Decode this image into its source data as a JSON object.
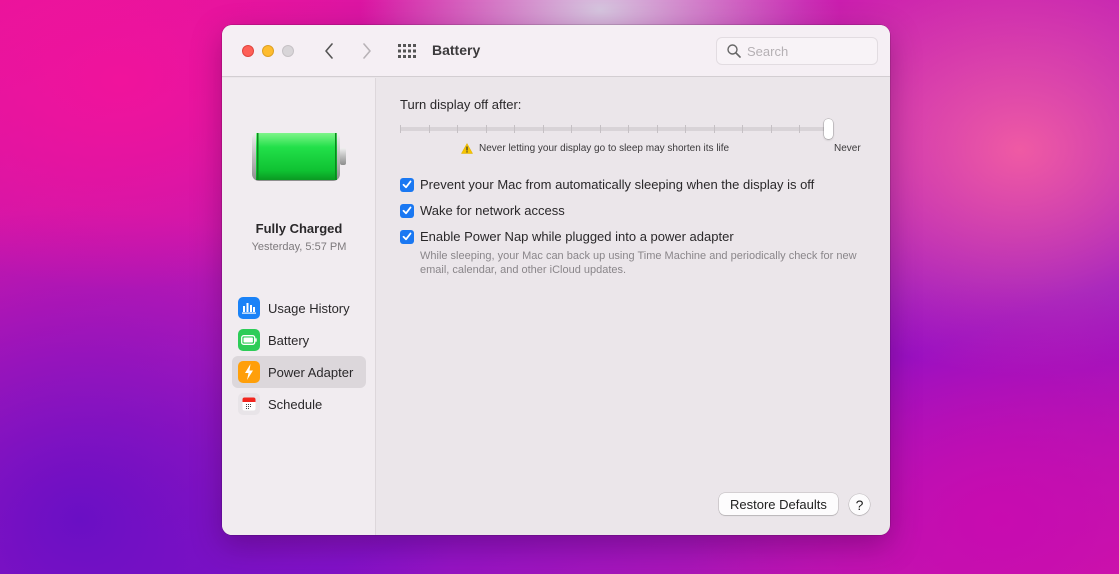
{
  "window": {
    "title": "Battery",
    "search": {
      "placeholder": "Search",
      "value": ""
    }
  },
  "sidebar": {
    "status": {
      "title": "Fully Charged",
      "time": "Yesterday, 5:57 PM"
    },
    "items": [
      {
        "label": "Usage History",
        "icon": "bar-chart-icon",
        "color": "#1a82f7",
        "active": false
      },
      {
        "label": "Battery",
        "icon": "battery-icon",
        "color": "#2dcc58",
        "active": false
      },
      {
        "label": "Power Adapter",
        "icon": "lightning-icon",
        "color": "#ff9f0a",
        "active": true
      },
      {
        "label": "Schedule",
        "icon": "calendar-icon",
        "color": "#e8e4e8",
        "active": false
      }
    ]
  },
  "main": {
    "slider": {
      "label": "Turn display off after:",
      "steps": 16,
      "selected_step": 16,
      "value_label": "Never",
      "warning": "Never letting your display go to sleep may shorten its life"
    },
    "options": [
      {
        "label": "Prevent your Mac from automatically sleeping when the display is off",
        "checked": true
      },
      {
        "label": "Wake for network access",
        "checked": true
      },
      {
        "label": "Enable Power Nap while plugged into a power adapter",
        "checked": true
      }
    ],
    "power_nap_description": "While sleeping, your Mac can back up using Time Machine and periodically check for new email, calendar, and other iCloud updates."
  },
  "footer": {
    "restore_label": "Restore Defaults",
    "help_label": "?"
  },
  "colors": {
    "accent": "#1a78f2",
    "battery_fill": "#22e04a",
    "warning": "#f5c400"
  }
}
